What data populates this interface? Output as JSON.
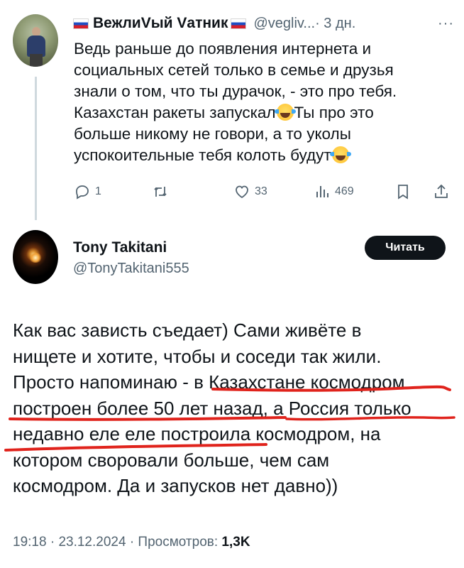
{
  "reply_tweet": {
    "display_name": "ВежлиVый Vатник",
    "handle": "@vegliv...",
    "time": "· 3 дн.",
    "more": "···",
    "text_lines": [
      "Ведь раньше до появления интернета и",
      "социальных сетей только в семье и друзья",
      "знали о том, что ты дурачок, - это про тебя.",
      "Казахстан ракеты запускал",
      "Ты про это",
      "больше никому не говори, а то уколы",
      "успокоительные тебя колоть будут"
    ],
    "actions": {
      "replies": "1",
      "retweets": "",
      "likes": "33",
      "views": "469"
    },
    "icons": [
      "reply-icon",
      "retweet-icon",
      "like-icon",
      "views-icon",
      "bookmark-icon",
      "share-icon"
    ]
  },
  "main_tweet": {
    "display_name": "Tony Takitani",
    "handle": "@TonyTakitani555",
    "follow_label": "Читать",
    "text_lines": [
      "Как вас зависть съедает) Сами живёте в",
      "нищете и хотите, чтобы и соседи так жили.",
      "Просто напоминаю - в Казахстане космодром",
      "построен более 50 лет назад, а Россия только",
      "недавно еле еле построила космодром, на",
      "котором своровали больше, чем сам",
      "космодром. Да и запусков нет давно))"
    ],
    "meta": {
      "time": "19:18",
      "date": "23.12.2024",
      "views_label": "Просмотров:",
      "views_count": "1,3K"
    }
  },
  "colors": {
    "text": "#0f1419",
    "secondary": "#536471",
    "thread_line": "#cfd9de",
    "highlight_underline": "#e0231c",
    "button_bg": "#0f1419"
  }
}
